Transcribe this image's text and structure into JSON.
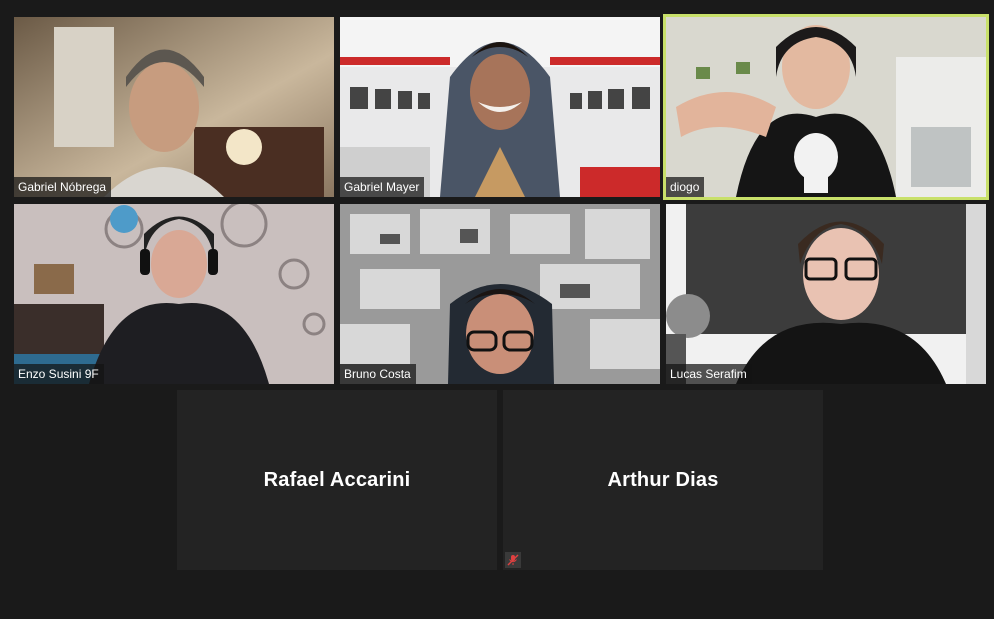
{
  "participants": [
    {
      "name": "Gabriel Nóbrega",
      "video": true,
      "active_speaker": false
    },
    {
      "name": "Gabriel Mayer",
      "video": true,
      "active_speaker": false
    },
    {
      "name": "diogo",
      "video": true,
      "active_speaker": true
    },
    {
      "name": "Enzo Susini 9F",
      "video": true,
      "active_speaker": false
    },
    {
      "name": "Bruno Costa",
      "video": true,
      "active_speaker": false
    },
    {
      "name": "Lucas Serafim",
      "video": true,
      "active_speaker": false
    },
    {
      "name": "Rafael Accarini",
      "video": false,
      "muted": false
    },
    {
      "name": "Arthur Dias",
      "video": false,
      "muted": true
    }
  ],
  "colors": {
    "background": "#1a1a1a",
    "active_speaker_border": "#c8e06a",
    "muted_icon": "#e04040"
  },
  "icons": [
    "mic-muted-icon"
  ]
}
